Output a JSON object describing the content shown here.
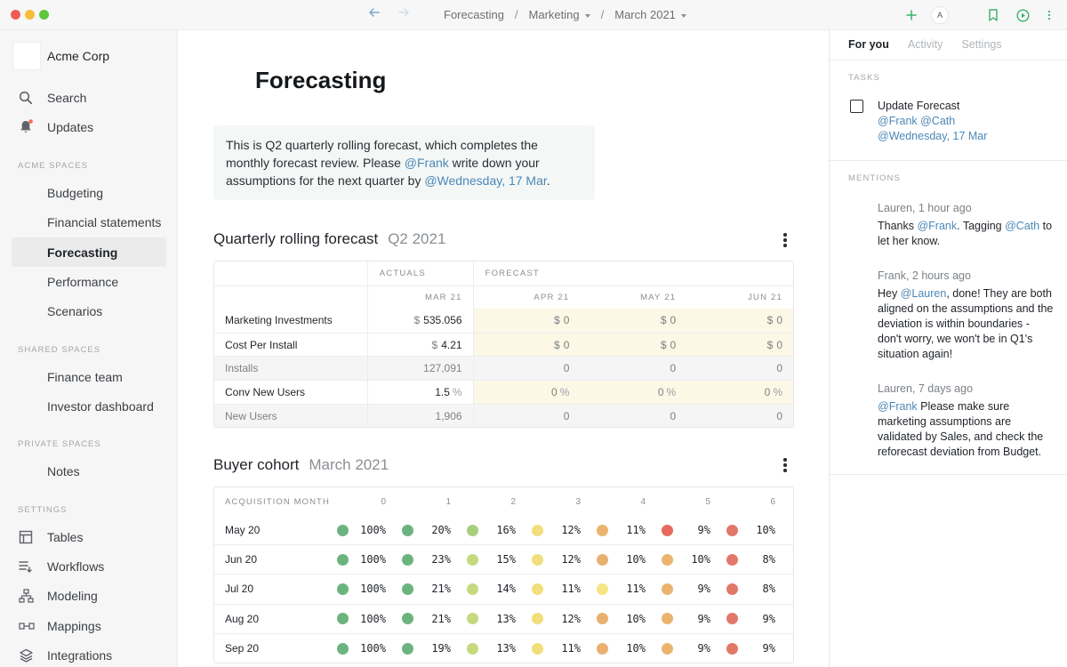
{
  "titlebar": {
    "breadcrumbs": [
      "Forecasting",
      "Marketing",
      "March 2021"
    ],
    "separator": "/",
    "avatar_letter": "A"
  },
  "sidebar": {
    "org_name": "Acme Corp",
    "top_items": [
      {
        "label": "Search",
        "icon": "search-icon"
      },
      {
        "label": "Updates",
        "icon": "bell-icon"
      }
    ],
    "sections": [
      {
        "title": "ACME SPACES",
        "items": [
          "Budgeting",
          "Financial statements",
          "Forecasting",
          "Performance",
          "Scenarios"
        ]
      },
      {
        "title": "SHARED SPACES",
        "items": [
          "Finance team",
          "Investor dashboard"
        ]
      },
      {
        "title": "PRIVATE SPACES",
        "items": [
          "Notes"
        ]
      },
      {
        "title": "SETTINGS",
        "items": [
          "Tables",
          "Workflows",
          "Modeling",
          "Mappings",
          "Integrations"
        ]
      }
    ],
    "active_item": "Forecasting"
  },
  "main": {
    "title": "Forecasting",
    "callout": {
      "part1": "This is Q2 quarterly rolling forecast, which completes the monthly forecast review. Please ",
      "mention1": "@Frank",
      "part2": " write down your assumptions for the next quarter by ",
      "mention2": "@Wednesday, 17 Mar",
      "part3": "."
    },
    "forecast": {
      "title": "Quarterly rolling forecast",
      "subtitle": "Q2 2021",
      "group_actuals": "ACTUALS",
      "group_forecast": "FORECAST",
      "columns": [
        "MAR 21",
        "APR 21",
        "MAY 21",
        "JUN 21"
      ],
      "rows": [
        {
          "label": "Marketing Investments",
          "prefix": "$",
          "suffix": "",
          "values": [
            "535.056",
            "0",
            "0",
            "0"
          ],
          "computed": false
        },
        {
          "label": "Cost Per Install",
          "prefix": "$",
          "suffix": "",
          "values": [
            "4.21",
            "0",
            "0",
            "0"
          ],
          "computed": false
        },
        {
          "label": "Installs",
          "prefix": "",
          "suffix": "",
          "values": [
            "127,091",
            "0",
            "0",
            "0"
          ],
          "computed": true
        },
        {
          "label": "Conv New Users",
          "prefix": "",
          "suffix": "%",
          "values": [
            "1.5",
            "0",
            "0",
            "0"
          ],
          "computed": false
        },
        {
          "label": "New Users",
          "prefix": "",
          "suffix": "",
          "values": [
            "1,906",
            "0",
            "0",
            "0"
          ],
          "computed": true
        }
      ]
    },
    "cohort": {
      "title": "Buyer cohort",
      "subtitle": "March 2021",
      "header_label": "ACQUISITION MONTH",
      "columns": [
        "0",
        "1",
        "2",
        "3",
        "4",
        "5",
        "6"
      ],
      "rows": [
        {
          "month": "May 20",
          "values": [
            "100%",
            "20%",
            "16%",
            "12%",
            "11%",
            "9%",
            "10%"
          ]
        },
        {
          "month": "Jun 20",
          "values": [
            "100%",
            "23%",
            "15%",
            "12%",
            "10%",
            "10%",
            "8%"
          ]
        },
        {
          "month": "Jul 20",
          "values": [
            "100%",
            "21%",
            "14%",
            "11%",
            "11%",
            "9%",
            "8%"
          ]
        },
        {
          "month": "Aug 20",
          "values": [
            "100%",
            "21%",
            "13%",
            "12%",
            "10%",
            "9%",
            "9%"
          ]
        },
        {
          "month": "Sep 20",
          "values": [
            "100%",
            "19%",
            "13%",
            "11%",
            "10%",
            "9%",
            "9%"
          ]
        }
      ],
      "dot_colors": [
        [
          "#6cb47f",
          "#6cb47f",
          "#a9cf7d",
          "#f0df7a",
          "#eab46f",
          "#e76a5f",
          "#e2786a"
        ],
        [
          "#6cb47f",
          "#6cb47f",
          "#c6d97f",
          "#f0df7a",
          "#eab070",
          "#eab46f",
          "#e2786a"
        ],
        [
          "#6cb47f",
          "#6cb47f",
          "#c6d97f",
          "#f0df7a",
          "#f5e584",
          "#eab46f",
          "#e2786a"
        ],
        [
          "#6cb47f",
          "#6cb47f",
          "#c6d97f",
          "#f0df7a",
          "#eab070",
          "#eab46f",
          "#e2786a"
        ],
        [
          "#6cb47f",
          "#6cb47f",
          "#c6d97f",
          "#f0df7a",
          "#eab070",
          "#eab46f",
          "#e2786a"
        ]
      ]
    }
  },
  "rpanel": {
    "tabs": [
      "For you",
      "Activity",
      "Settings"
    ],
    "tasks_label": "TASKS",
    "task": {
      "title": "Update Forecast",
      "mentions": "@Frank @Cath",
      "date": "@Wednesday, 17 Mar"
    },
    "mentions_label": "MENTIONS",
    "mentions": [
      {
        "meta": "Lauren, 1 hour ago",
        "pre": "Thanks ",
        "m1": "@Frank",
        "mid": ". Tagging ",
        "m2": "@Cath",
        "post": " to let her know."
      },
      {
        "meta": "Frank, 2 hours ago",
        "pre": "Hey ",
        "m1": "@Lauren",
        "mid": ", done! They are both aligned on the assumptions and the deviation is within boundaries - don't worry, we won't be in Q1's situation again!",
        "m2": "",
        "post": ""
      },
      {
        "meta": "Lauren, 7 days ago",
        "pre": "",
        "m1": "@Frank",
        "mid": " Please make sure marketing assumptions are validated by Sales, and check the reforecast deviation from Budget.",
        "m2": "",
        "post": ""
      }
    ]
  },
  "colors": {
    "accent_link": "#4b88b8",
    "forecast_cell": "#fdf7e6",
    "nav_arrow": "#8fb1cf",
    "add_green": "#3bb06b"
  }
}
